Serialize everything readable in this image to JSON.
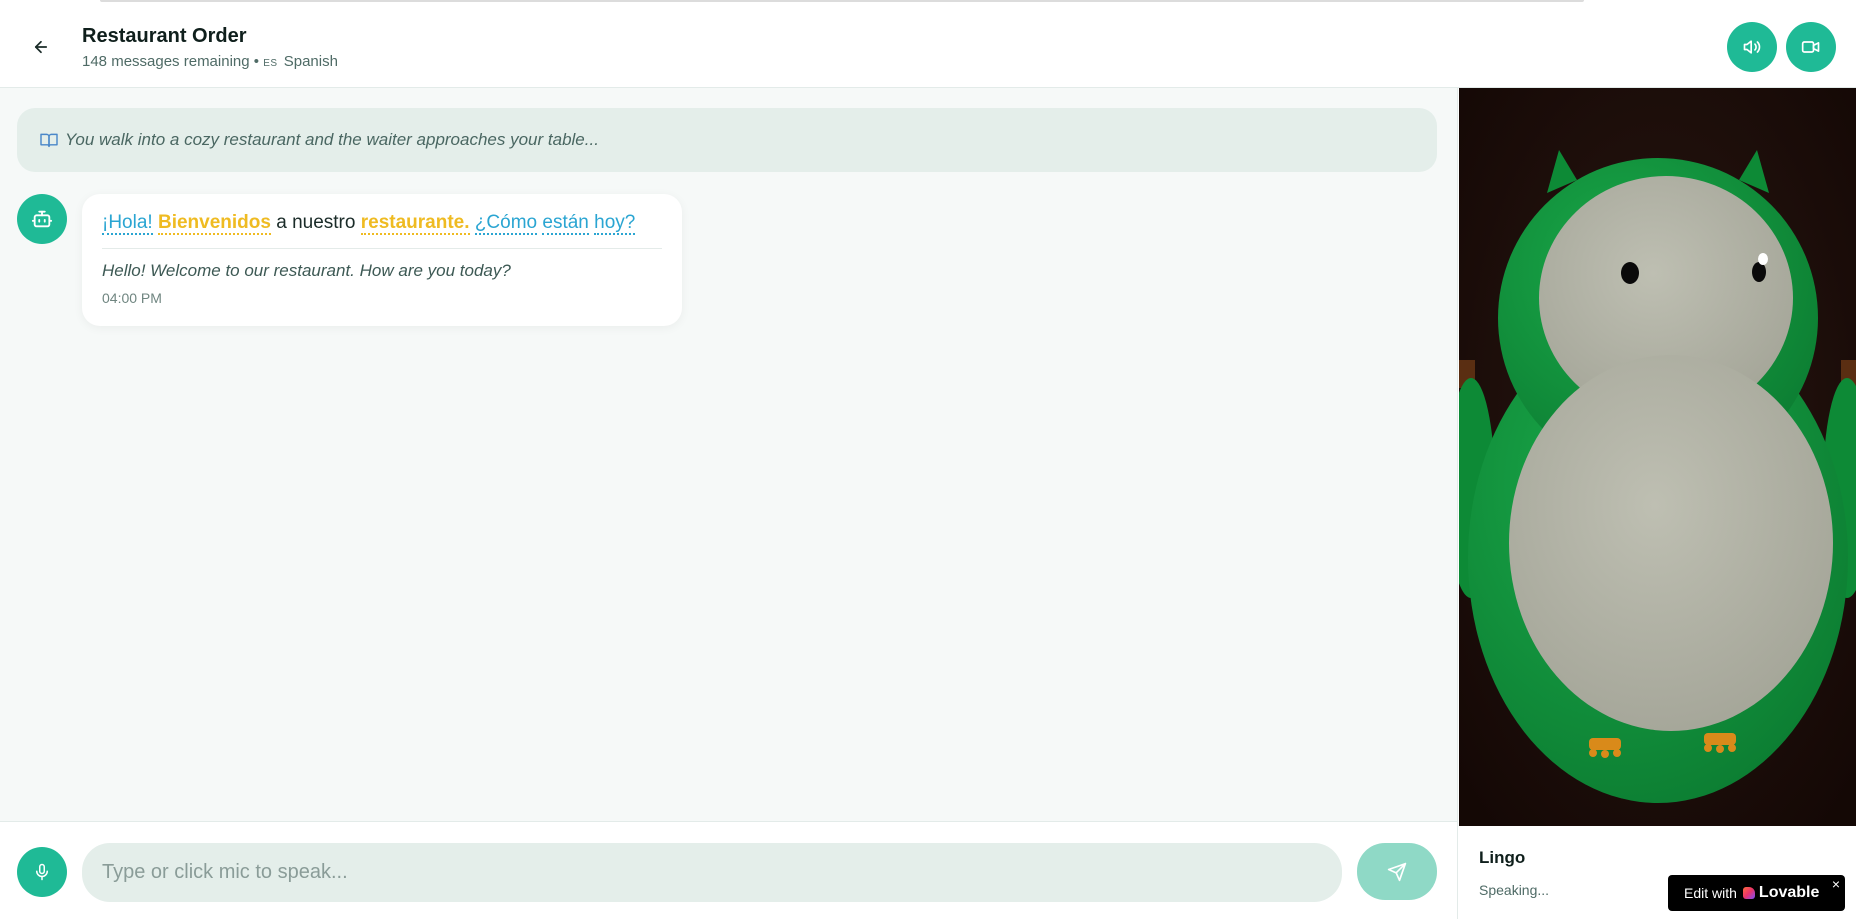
{
  "header": {
    "title": "Restaurant Order",
    "remaining": "148 messages remaining",
    "separator": "•",
    "language_code": "ES",
    "language": "Spanish",
    "icons": {
      "back": "arrow-left-icon",
      "sound": "volume-icon",
      "video": "video-camera-icon"
    }
  },
  "chat": {
    "scenario": "You walk into a cozy restaurant and the waiter approaches your table...",
    "message": {
      "words": {
        "w1": "¡Hola!",
        "w2": "Bienvenidos",
        "w3": "a nuestro",
        "w4": "restaurante.",
        "w5": "¿Cómo",
        "w6": "están",
        "w7": "hoy?"
      },
      "translation": "Hello! Welcome to our restaurant. How are you today?",
      "time": "04:00 PM"
    },
    "colors": {
      "known_word": "#2aa5d2",
      "new_word": "#efbb22"
    }
  },
  "input": {
    "placeholder": "Type or click mic to speak..."
  },
  "avatar": {
    "name": "Lingo",
    "status": "Speaking..."
  },
  "badge": {
    "prefix": "Edit with",
    "brand": "Lovable",
    "close": "×"
  },
  "theme": {
    "accent": "#1fba96",
    "scene_background": "#1c0e0a",
    "owl_green": "#0f9a3d",
    "owl_belly": "#b5b6a8"
  }
}
